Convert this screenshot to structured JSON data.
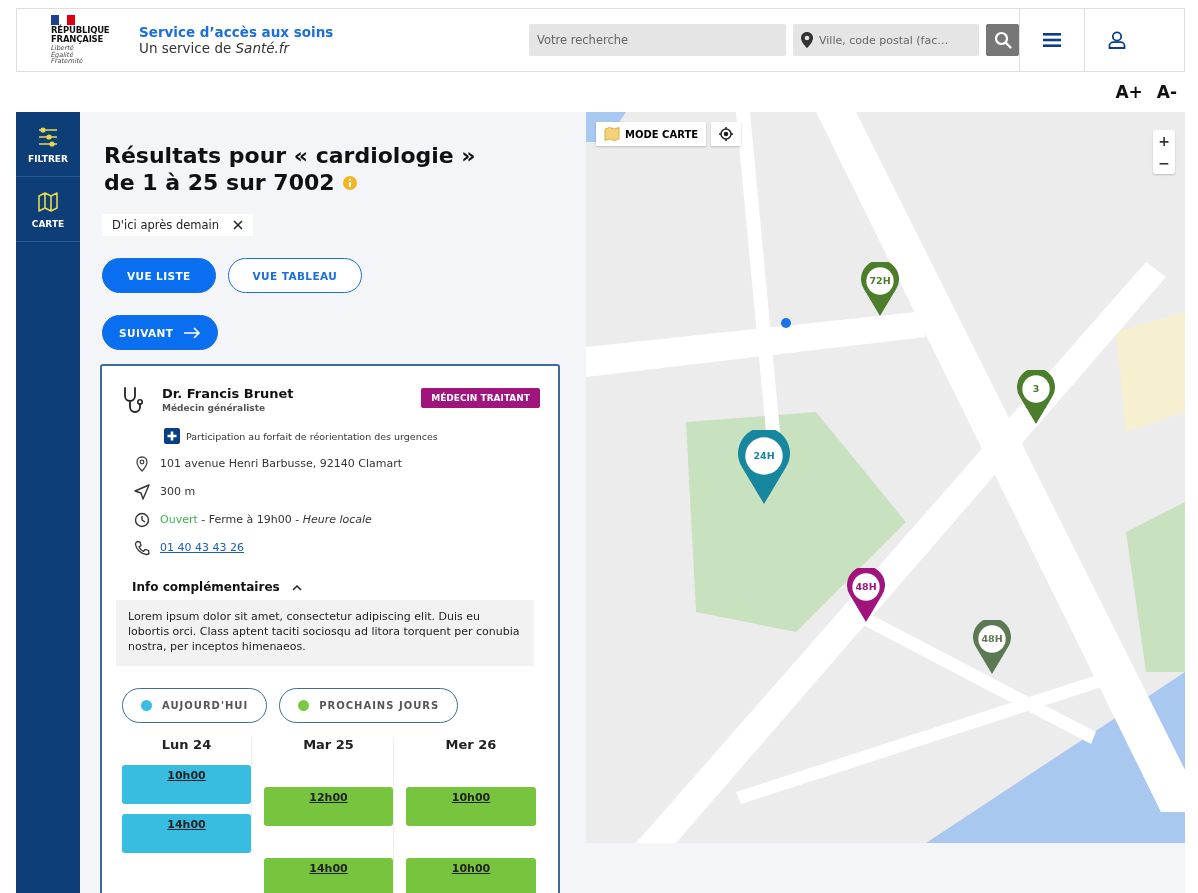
{
  "header": {
    "logo": {
      "name_lines": [
        "RÉPUBLIQUE",
        "FRANÇAISE"
      ],
      "motto_lines": [
        "Liberté",
        "Égalité",
        "Fraternité"
      ]
    },
    "service_title": "Service d’accès aux soins",
    "service_subtitle": "Un service de *Santé.fr*",
    "search": {
      "placeholder": "Votre recherche"
    },
    "location": {
      "placeholder": "Ville, code postal (fac…"
    }
  },
  "font_size_buttons": [
    "A+",
    "A-"
  ],
  "sidebar": {
    "items": [
      {
        "label": "FILTRER",
        "kind": "filter"
      },
      {
        "label": "CARTE",
        "kind": "map"
      }
    ]
  },
  "results": {
    "title_lines": [
      "Résultats pour « cardiologie »",
      "de 1 à 25 sur 7002"
    ],
    "filter_chip": "D'ici après demain",
    "view_buttons": [
      {
        "label": "VUE LISTE",
        "selected": true
      },
      {
        "label": "VUE TABLEAU",
        "selected": false
      }
    ],
    "next_button": "SUIVANT"
  },
  "card": {
    "name": "Dr. Francis Brunet",
    "specialty": "Médecin généraliste",
    "badge": "MÉDECIN TRAITANT",
    "participation": "Participation au forfait de réorientation des urgences",
    "address": "101 avenue Henri Barbusse, 92140 Clamart",
    "distance": "300 m",
    "status": "Ouvert",
    "open": true,
    "hours_detail": "- Ferme à 19h00 - *Heure locale*",
    "phone": "01 40 43 43 26",
    "info": {
      "title": "Info complémentaires",
      "expanded": true,
      "text": "Lorem ipsum dolor sit amet, consectetur adipiscing elit. Duis eu lobortis orci. Class aptent taciti sociosqu ad litora torquent per conubia nostra, per inceptos himenaeos."
    },
    "legend": [
      {
        "label": "AUJOURD'HUI",
        "color": "#3bbde0"
      },
      {
        "label": "PROCHAINS JOURS",
        "color": "#7ac943"
      }
    ],
    "days": [
      {
        "label": "Lun 24",
        "kind": "today",
        "slots": [
          "10h00",
          "14h00"
        ]
      },
      {
        "label": "Mar 25",
        "kind": "next",
        "slots": [
          "12h00",
          "14h00"
        ]
      },
      {
        "label": "Mer 26",
        "kind": "next",
        "slots": [
          "10h00",
          "10h00"
        ]
      }
    ]
  },
  "map": {
    "mode_button": "MODE CARTE",
    "zoom_buttons": [
      "+",
      "−"
    ],
    "pins": [
      {
        "label": "72H",
        "color": "#4b7d2b"
      },
      {
        "label": "3",
        "color": "#4b7d2b"
      },
      {
        "label": "24H",
        "color": "#17869f"
      },
      {
        "label": "48H",
        "color": "#a0157d"
      },
      {
        "label": "48H",
        "color": "#5b7a52"
      }
    ]
  }
}
